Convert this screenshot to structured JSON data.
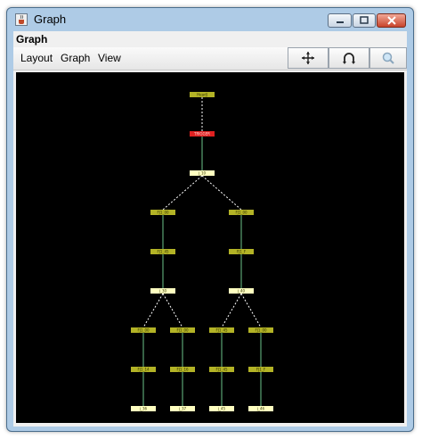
{
  "window": {
    "title": "Graph",
    "frame_label": "Graph"
  },
  "menu": {
    "items": [
      "Layout",
      "Graph",
      "View"
    ]
  },
  "toolbar": {
    "icons": [
      "move-arrows-icon",
      "rotate-icon",
      "zoom-icon"
    ]
  },
  "colors": {
    "canvas_bg": "#000000",
    "node_olive": "#b3b326",
    "node_cream": "#ffffc0",
    "node_red": "#e02020",
    "edge_solid": "#6cc58a",
    "edge_dashed": "#ffffff"
  },
  "graph": {
    "nodes": [
      {
        "id": "n0",
        "label": "HeadJ",
        "kind": "olive"
      },
      {
        "id": "n1",
        "label": "TRIGGER",
        "kind": "red"
      },
      {
        "id": "n2",
        "label": "j_10",
        "kind": "cream"
      },
      {
        "id": "n3",
        "label": "FJ1_00",
        "kind": "olive"
      },
      {
        "id": "n4",
        "label": "FJ1_00",
        "kind": "olive"
      },
      {
        "id": "n5",
        "label": "FJ1_45",
        "kind": "olive"
      },
      {
        "id": "n6",
        "label": "FJ1_F",
        "kind": "olive"
      },
      {
        "id": "n7",
        "label": "j_30",
        "kind": "cream"
      },
      {
        "id": "n8",
        "label": "j_40",
        "kind": "cream"
      },
      {
        "id": "n9",
        "label": "FJ1_00",
        "kind": "olive"
      },
      {
        "id": "n10",
        "label": "FJ1_00",
        "kind": "olive"
      },
      {
        "id": "n11",
        "label": "FJ1_45",
        "kind": "olive"
      },
      {
        "id": "n12",
        "label": "FJ1_00",
        "kind": "olive"
      },
      {
        "id": "n13",
        "label": "FJ1_14",
        "kind": "olive"
      },
      {
        "id": "n14",
        "label": "FJ1_16",
        "kind": "olive"
      },
      {
        "id": "n15",
        "label": "FJ1_45",
        "kind": "olive"
      },
      {
        "id": "n16",
        "label": "FJ1_F",
        "kind": "olive"
      },
      {
        "id": "n17",
        "label": "j_36",
        "kind": "cream"
      },
      {
        "id": "n18",
        "label": "j_37",
        "kind": "cream"
      },
      {
        "id": "n19",
        "label": "j_45",
        "kind": "cream"
      },
      {
        "id": "n20",
        "label": "j_46",
        "kind": "cream"
      }
    ],
    "edges": [
      {
        "from": "n0",
        "to": "n1",
        "style": "dashed"
      },
      {
        "from": "n1",
        "to": "n2",
        "style": "solid"
      },
      {
        "from": "n2",
        "to": "n3",
        "style": "dashed"
      },
      {
        "from": "n2",
        "to": "n4",
        "style": "dashed"
      },
      {
        "from": "n3",
        "to": "n5",
        "style": "solid"
      },
      {
        "from": "n4",
        "to": "n6",
        "style": "solid"
      },
      {
        "from": "n5",
        "to": "n7",
        "style": "solid"
      },
      {
        "from": "n6",
        "to": "n8",
        "style": "solid"
      },
      {
        "from": "n7",
        "to": "n9",
        "style": "dashed"
      },
      {
        "from": "n7",
        "to": "n10",
        "style": "dashed"
      },
      {
        "from": "n8",
        "to": "n11",
        "style": "dashed"
      },
      {
        "from": "n8",
        "to": "n12",
        "style": "dashed"
      },
      {
        "from": "n9",
        "to": "n13",
        "style": "solid"
      },
      {
        "from": "n10",
        "to": "n14",
        "style": "solid"
      },
      {
        "from": "n11",
        "to": "n15",
        "style": "solid"
      },
      {
        "from": "n12",
        "to": "n16",
        "style": "solid"
      },
      {
        "from": "n13",
        "to": "n17",
        "style": "solid"
      },
      {
        "from": "n14",
        "to": "n18",
        "style": "solid"
      },
      {
        "from": "n15",
        "to": "n19",
        "style": "solid"
      },
      {
        "from": "n16",
        "to": "n20",
        "style": "solid"
      }
    ]
  }
}
